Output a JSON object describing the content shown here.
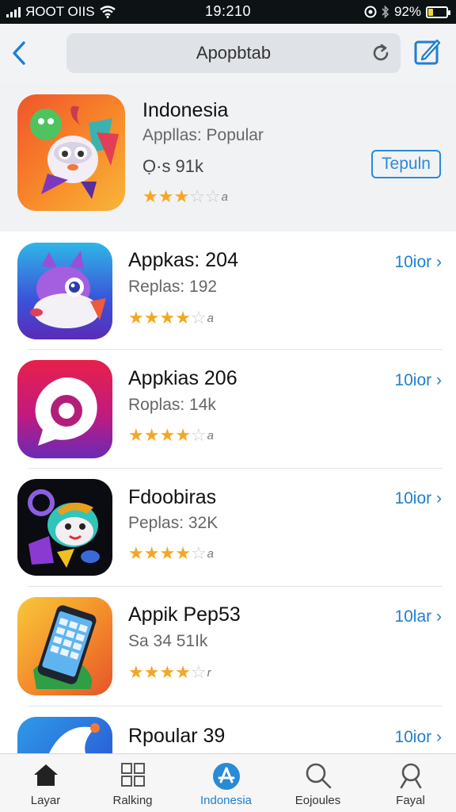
{
  "status_bar": {
    "carrier": "ЯOOT OIIS",
    "time": "19:210",
    "battery": "92%",
    "battery_level": 0.25
  },
  "nav": {
    "search_text": "Apopbtab",
    "back_icon": "chevron-left-icon",
    "reload_icon": "reload-icon",
    "compose_icon": "compose-icon"
  },
  "featured": {
    "title": "Indonesia",
    "subtitle": "Appllas: Popular",
    "meta": "Ọ·s  91k",
    "button": "Tepuln",
    "stars": {
      "filled": 3,
      "total": 5,
      "count": "a"
    }
  },
  "apps": [
    {
      "title": "Appkas: 204",
      "subtitle": "Replas: 192",
      "action": "10ior",
      "stars": {
        "filled": 4,
        "total": 5,
        "count": "a"
      }
    },
    {
      "title": "Appkias 206",
      "subtitle": "Roplas: 14k",
      "action": "10ior",
      "stars": {
        "filled": 4,
        "total": 5,
        "count": "a"
      }
    },
    {
      "title": "Fdoobiras",
      "subtitle": "Peplas: 32K",
      "action": "10ior",
      "stars": {
        "filled": 4,
        "total": 5,
        "count": "a"
      }
    },
    {
      "title": "Appik Pep53",
      "subtitle": "Sa 34 51Ik",
      "action": "10lar",
      "stars": {
        "filled": 4,
        "total": 5,
        "count": "r"
      }
    },
    {
      "title": "Rpoular 39",
      "action": "10ior"
    }
  ],
  "tabs": [
    {
      "label": "Layar",
      "icon": "home-icon"
    },
    {
      "label": "Ralking",
      "icon": "grid-icon"
    },
    {
      "label": "Indonesia",
      "icon": "app-store-icon",
      "active": true
    },
    {
      "label": "Eojoules",
      "icon": "search-icon"
    },
    {
      "label": "Fayal",
      "icon": "search-icon"
    }
  ],
  "colors": {
    "accent": "#1f7fd0",
    "star": "#f5a623",
    "status_bar": "#0d1214"
  }
}
